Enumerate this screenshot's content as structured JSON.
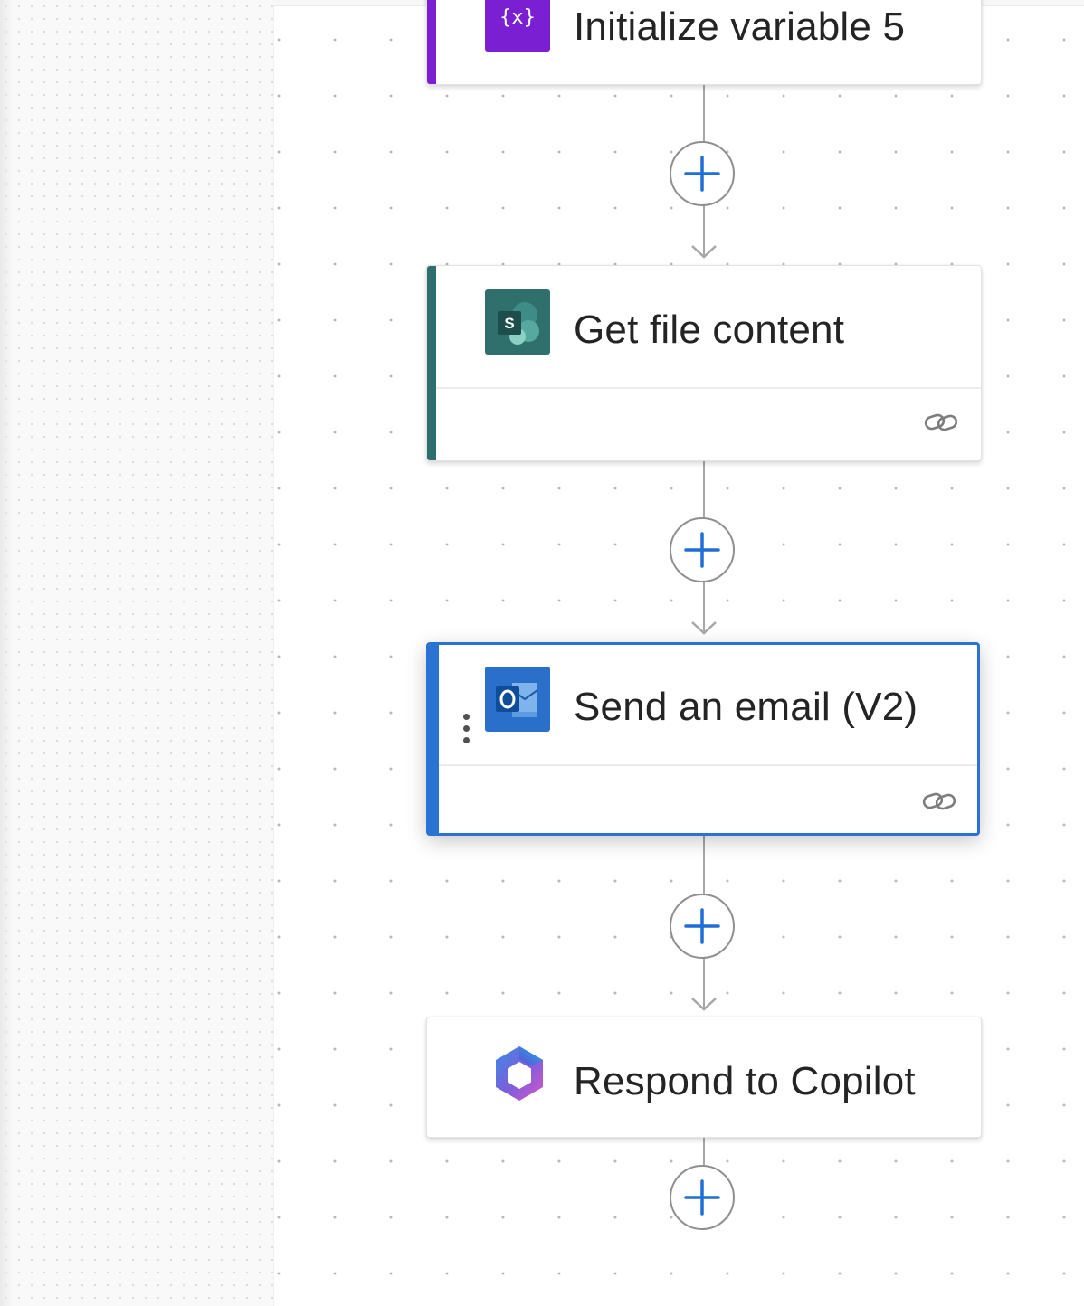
{
  "canvas": {
    "actions": [
      {
        "id": "initialize-variable",
        "title": "Initialize variable 5",
        "icon": "variable-icon",
        "icon_glyph": "{x}",
        "accent": "#7a1fd1"
      },
      {
        "id": "get-file-content",
        "title": "Get file content",
        "icon": "sharepoint-icon",
        "accent": "#2e6f6d"
      },
      {
        "id": "send-email",
        "title": "Send an email (V2)",
        "icon": "outlook-icon",
        "accent": "#2b73d2",
        "selected": true
      },
      {
        "id": "respond-to-copilot",
        "title": "Respond to Copilot",
        "icon": "copilot-icon"
      }
    ],
    "colors": {
      "add_plus": "#1f6fd6",
      "selection": "#2b73d2",
      "connector": "#a7a7a7"
    }
  }
}
